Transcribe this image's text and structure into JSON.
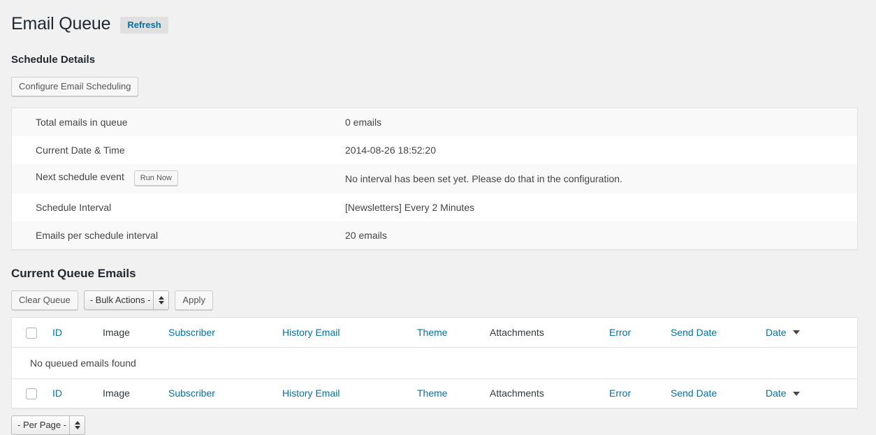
{
  "page": {
    "title": "Email Queue",
    "refresh_label": "Refresh"
  },
  "schedule_section": {
    "heading": "Schedule Details",
    "configure_button": "Configure Email Scheduling",
    "rows": [
      {
        "label": "Total emails in queue",
        "value": "0 emails",
        "button": null
      },
      {
        "label": "Current Date & Time",
        "value": "2014-08-26 18:52:20",
        "button": null
      },
      {
        "label": "Next schedule event",
        "value": "No interval has been set yet. Please do that in the configuration.",
        "button": "Run Now"
      },
      {
        "label": "Schedule Interval",
        "value": "[Newsletters] Every 2 Minutes",
        "button": null
      },
      {
        "label": "Emails per schedule interval",
        "value": "20 emails",
        "button": null
      }
    ]
  },
  "queue_section": {
    "heading": "Current Queue Emails",
    "clear_queue_label": "Clear Queue",
    "bulk_actions_value": "- Bulk Actions -",
    "apply_label": "Apply",
    "per_page_value": "- Per Page -",
    "empty_message": "No queued emails found",
    "columns": [
      {
        "label": "ID",
        "sortable": true
      },
      {
        "label": "Image",
        "sortable": false
      },
      {
        "label": "Subscriber",
        "sortable": true
      },
      {
        "label": "History Email",
        "sortable": true
      },
      {
        "label": "Theme",
        "sortable": true
      },
      {
        "label": "Attachments",
        "sortable": false
      },
      {
        "label": "Error",
        "sortable": true
      },
      {
        "label": "Send Date",
        "sortable": true
      },
      {
        "label": "Date",
        "sortable": true,
        "sorted": "desc"
      }
    ]
  },
  "colors": {
    "page_background": "#f1f1f1",
    "link": "#0073aa",
    "heading": "#23282d",
    "badge_background": "#e0e0e0",
    "table_border": "#e1e1e1",
    "stripe": "#f9f9f9"
  }
}
